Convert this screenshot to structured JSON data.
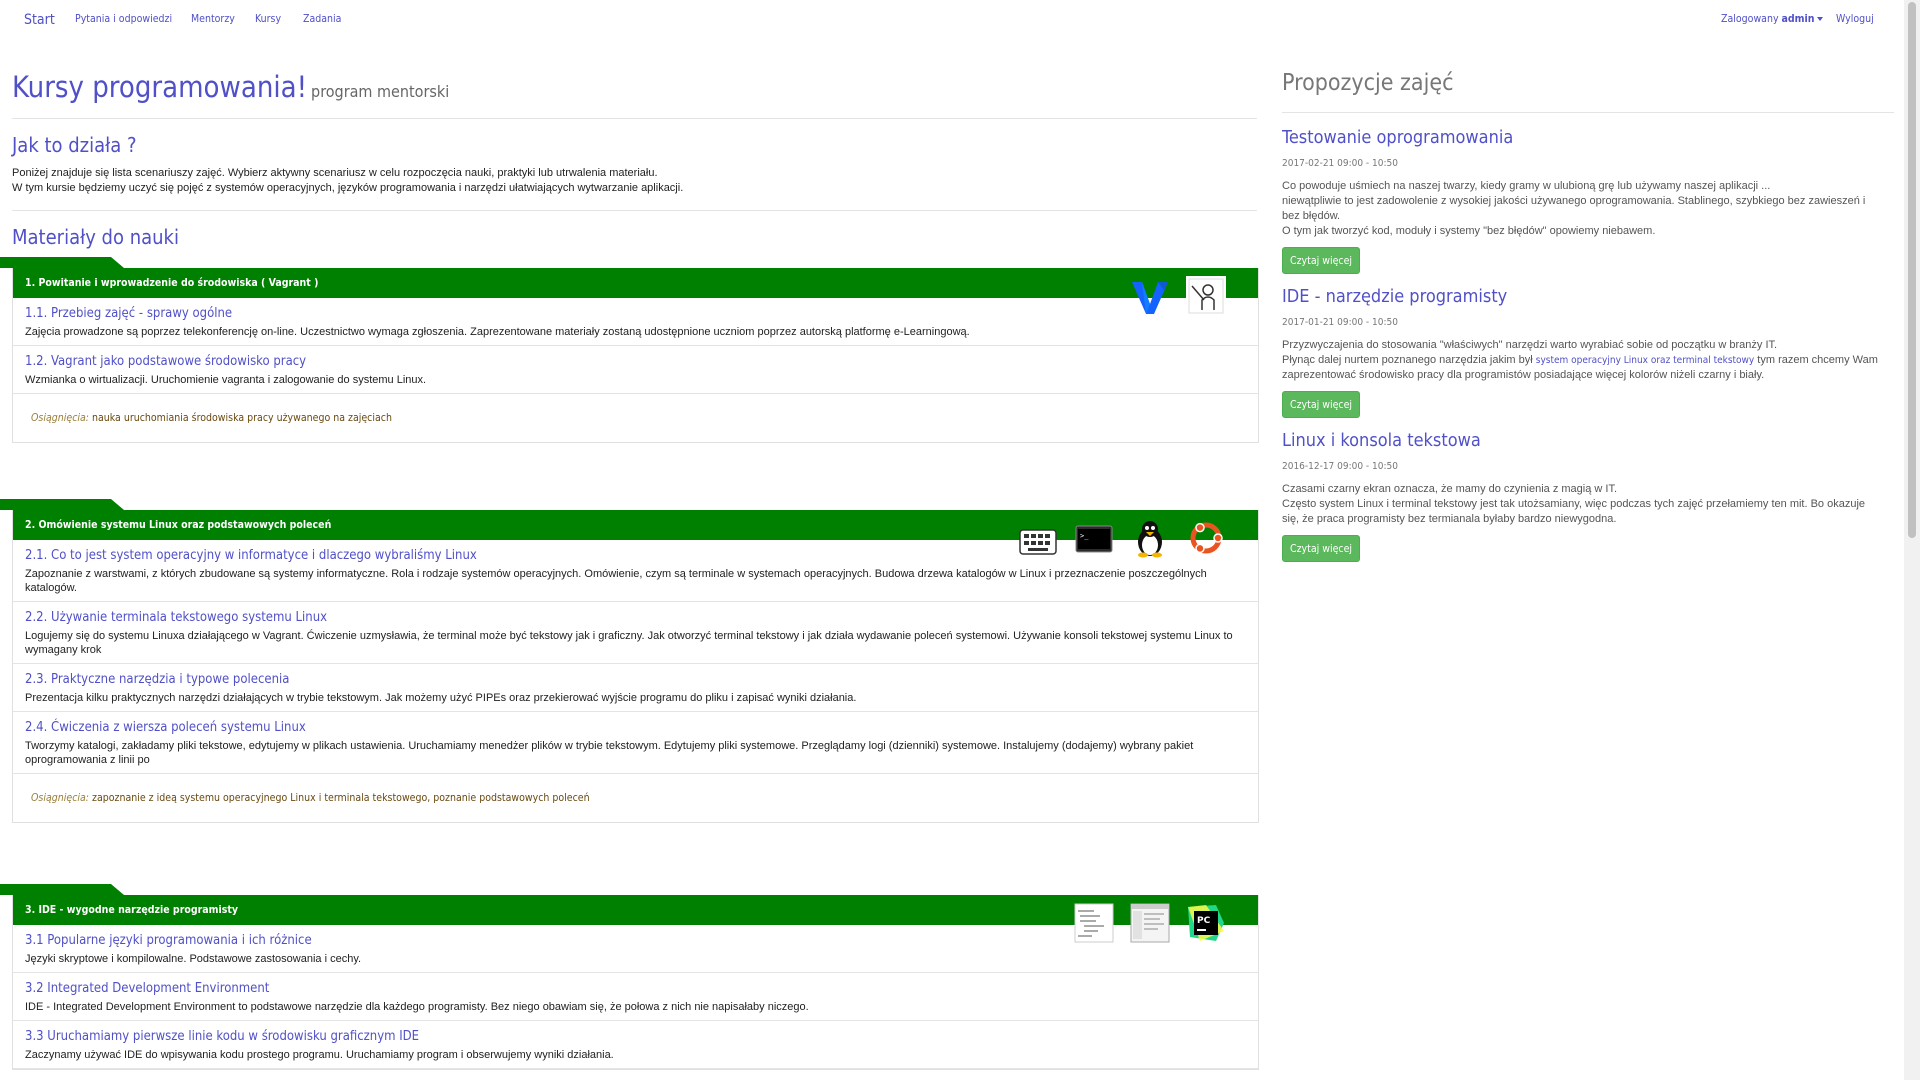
{
  "nav": {
    "brand": "Start",
    "links": [
      "Pytania i odpowiedzi",
      "Mentorzy",
      "Kursy",
      "Zadania"
    ],
    "logged_prefix": "Zalogowany",
    "user": "admin",
    "logout": "Wyloguj"
  },
  "page": {
    "title": "Kursy programowania!",
    "subtitle": "program mentorski"
  },
  "how": {
    "heading": "Jak to działa ?",
    "line1": "Poniżej znajduje się lista scenariuszy zajęć. Wybierz aktywny scenariusz w celu rozpoczęcia nauki, praktyki lub utrwalenia materiału.",
    "line2": "W tym kursie będziemy uczyć się pojęć z systemów operacyjnych, języków programowania i narzędzi ułatwiających wytwarzanie aplikacji."
  },
  "materials": {
    "heading": "Materiały do nauki",
    "achievements_label": "Osiągnięcia:",
    "modules": [
      {
        "title": "1. Powitanie i wprowadzenie do środowiska ( Vagrant )",
        "icons": [
          "vagrant-logo-icon",
          "teacher-icon"
        ],
        "lessons": [
          {
            "title": "1.1. Przebieg zajęć - sprawy ogólne",
            "desc": "Zajęcia prowadzone są poprzez telekonferencję on-line. Uczestnictwo wymaga zgłoszenia. Zaprezentowane materiały zostaną udostępnione uczniom poprzez autorską platformę e-Learningową."
          },
          {
            "title": "1.2. Vagrant jako podstawowe środowisko pracy",
            "desc": "Wzmianka o wirtualizacji. Uruchomienie vagranta i zalogowanie do systemu Linux."
          }
        ],
        "achievement": "nauka uruchomiania środowiska pracy używanego na zajęciach"
      },
      {
        "title": "2. Omówienie systemu Linux oraz podstawowych poleceń",
        "icons": [
          "keyboard-icon",
          "terminal-icon",
          "tux-linux-icon",
          "ubuntu-logo-icon"
        ],
        "lessons": [
          {
            "title": "2.1. Co to jest system operacyjny w informatyce i dlaczego wybraliśmy Linux",
            "desc": "Zapoznanie z warstwami, z których zbudowane są systemy informatyczne. Rola i rodzaje systemów operacyjnych. Omówienie, czym są terminale w systemach operacyjnych. Budowa drzewa katalogów w Linux i przeznaczenie poszczególnych katalogów."
          },
          {
            "title": "2.2. Używanie terminala tekstowego systemu Linux",
            "desc": "Logujemy się do systemu Linuxa działającego w Vagrant. Ćwiczenie uzmysławia, że terminal może być tekstowy jak i graficzny. Jak otworzyć terminal tekstowy i jak działa wydawanie poleceń systemowi. Używanie konsoli tekstowej systemu Linux to wymagany krok"
          },
          {
            "title": "2.3. Praktyczne narzędzia i typowe polecenia",
            "desc": "Prezentacja kilku praktycznych narzędzi działających w trybie tekstowym. Jak możemy użyć PIPEs oraz przekierować wyjście programu do pliku i zapisać wyniki działania."
          },
          {
            "title": "2.4. Ćwiczenia z wiersza poleceń systemu Linux",
            "desc": "Tworzymy katalogi, zakładamy pliki tekstowe, edytujemy w plikach ustawienia. Uruchamiamy menedżer plików w trybie tekstowym. Edytujemy pliki systemowe. Przeglądamy logi (dzienniki) systemowe. Instalujemy (dodajemy) wybrany pakiet oprogramowania z linii po"
          }
        ],
        "achievement": "zapoznanie z ideą systemu operacyjnego Linux i terminala tekstowego, poznanie podstawowych poleceń"
      },
      {
        "title": "3. IDE - wygodne narzędzie programisty",
        "icons": [
          "code-sheet-icon",
          "ide-window-icon",
          "pycharm-logo-icon"
        ],
        "lessons": [
          {
            "title": "3.1 Popularne języki programowania i ich różnice",
            "desc": "Języki skryptowe i kompilowalne. Podstawowe zastosowania i cechy."
          },
          {
            "title": "3.2 Integrated Development Environment",
            "desc": "IDE - Integrated Development Environment to podstawowe narzędzie dla każdego programisty. Bez niego obawiam się, że połowa z nich nie napisałaby niczego."
          },
          {
            "title": "3.3 Uruchamiamy pierwsze linie kodu w środowisku graficznym IDE",
            "desc": "Zaczynamy używać IDE do wpisywania kodu prostego programu. Uruchamiamy program i obserwujemy wyniki działania."
          }
        ]
      }
    ]
  },
  "proposals": {
    "heading": "Propozycje zajęć",
    "button": "Czytaj więcej",
    "items": [
      {
        "title": "Testowanie oprogramowania",
        "date": "2017-02-21 09:00 - 10:50",
        "lines": [
          "Co powoduje uśmiech na naszej twarzy, kiedy gramy w ulubioną grę lub używamy naszej aplikacji ...",
          "niewątpliwie to jest zadowolenie z wysokiej jakości używanego oprogramowania. Stablinego, szybkiego bez zawieszeń i bez błędów.",
          "O tym jak tworzyć kod, moduły i systemy \"bez błędów\" opowiemy niebawem."
        ]
      },
      {
        "title": "IDE - narzędzie programisty",
        "date": "2017-01-21 09:00 - 10:50",
        "line1": "Przyzwyczajenia do stosowania \"właściwych\" narzędzi warto wyrabiać sobie od początku w branży IT.",
        "line2_pre": "Płynąc dalej nurtem poznanego narzędzia jakim był ",
        "line2_link": "system operacyjny Linux oraz terminal tekstowy",
        "line2_post": " tym razem chcemy Wam zaprezentować środowisko pracy dla programistów posiadające więcej kolorów niżeli czarny i biały."
      },
      {
        "title": "Linux i konsola tekstowa",
        "date": "2016-12-17 09:00 - 10:50",
        "lines": [
          "Czasami czarny ekran oznacza, że mamy do czynienia z magią w IT.",
          "Często system Linux i terminal tekstowy jest tak utożsamiany, więc podczas tych zajęć przełamiemy ten mit. Bo okazuje się, że praca programisty bez termianala byłaby bardzo niewygodna."
        ]
      }
    ]
  }
}
